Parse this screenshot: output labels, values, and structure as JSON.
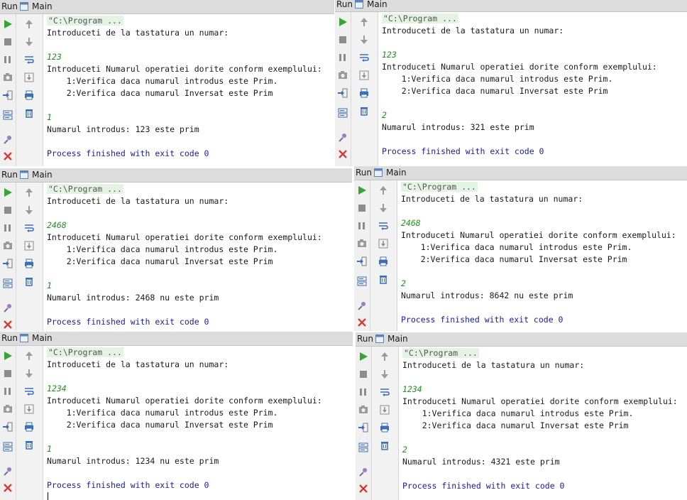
{
  "colors": {
    "header_bg": "#dcdcdc",
    "input_green": "#1f8f1f",
    "exit_blue": "#1a1aa0",
    "run_green": "#3aa335",
    "close_red": "#d43b3b"
  },
  "toolbar_icons": [
    "run-icon",
    "stop-icon",
    "pause-icon",
    "camera-icon",
    "import-icon",
    "layout-icon",
    "pin-icon",
    "close-icon"
  ],
  "scroll_icons": [
    "up-arrow-icon",
    "down-arrow-icon",
    "soft-wrap-icon",
    "scroll-to-end-icon",
    "print-icon",
    "trash-icon"
  ],
  "panels": [
    {
      "run_label": "Run",
      "tab_label": "Main",
      "command": "\"C:\\Program ...",
      "prompt_number": "Introduceti de la tastatura un numar:",
      "number": "123",
      "prompt_op": "Introduceti Numarul operatiei dorite conform exemplului:",
      "opt1": "    1:Verifica daca numarul introdus este Prim.",
      "opt2": "    2:Verifica daca numarul Inversat este Prim",
      "op": "1",
      "result": "Numarul introdus: 123 este prim",
      "exit": "Process finished with exit code 0"
    },
    {
      "run_label": "Run",
      "tab_label": "Main",
      "command": "\"C:\\Program ...",
      "prompt_number": "Introduceti de la tastatura un numar:",
      "number": "123",
      "prompt_op": "Introduceti Numarul operatiei dorite conform exemplului:",
      "opt1": "    1:Verifica daca numarul introdus este Prim.",
      "opt2": "    2:Verifica daca numarul Inversat este Prim",
      "op": "2",
      "result": "Numarul introdus: 321 este prim",
      "exit": "Process finished with exit code 0"
    },
    {
      "run_label": "Run",
      "tab_label": "Main",
      "command": "\"C:\\Program ...",
      "prompt_number": "Introduceti de la tastatura un numar:",
      "number": "2468",
      "prompt_op": "Introduceti Numarul operatiei dorite conform exemplului:",
      "opt1": "    1:Verifica daca numarul introdus este Prim.",
      "opt2": "    2:Verifica daca numarul Inversat este Prim",
      "op": "1",
      "result": "Numarul introdus: 2468 nu este prim",
      "exit": "Process finished with exit code 0"
    },
    {
      "run_label": "Run",
      "tab_label": "Main",
      "command": "\"C:\\Program ...",
      "prompt_number": "Introduceti de la tastatura un numar:",
      "number": "2468",
      "prompt_op": "Introduceti Numarul operatiei dorite conform exemplului:",
      "opt1": "    1:Verifica daca numarul introdus este Prim.",
      "opt2": "    2:Verifica daca numarul Inversat este Prim",
      "op": "2",
      "result": "Numarul introdus: 8642 nu este prim",
      "exit": "Process finished with exit code 0"
    },
    {
      "run_label": "Run",
      "tab_label": "Main",
      "command": "\"C:\\Program ...",
      "prompt_number": "Introduceti de la tastatura un numar:",
      "number": "1234",
      "prompt_op": "Introduceti Numarul operatiei dorite conform exemplului:",
      "opt1": "    1:Verifica daca numarul introdus este Prim.",
      "opt2": "    2:Verifica daca numarul Inversat este Prim",
      "op": "1",
      "result": "Numarul introdus: 1234 nu este prim",
      "exit": "Process finished with exit code 0"
    },
    {
      "run_label": "Run",
      "tab_label": "Main",
      "command": "\"C:\\Program ...",
      "prompt_number": "Introduceti de la tastatura un numar:",
      "number": "1234",
      "prompt_op": "Introduceti Numarul operatiei dorite conform exemplului:",
      "opt1": "    1:Verifica daca numarul introdus este Prim.",
      "opt2": "    2:Verifica daca numarul Inversat este Prim",
      "op": "2",
      "result": "Numarul introdus: 4321 este prim",
      "exit": "Process finished with exit code 0"
    }
  ]
}
